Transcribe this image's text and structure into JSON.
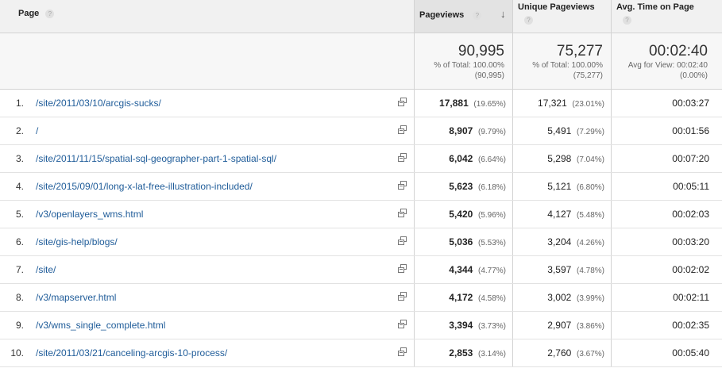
{
  "header": {
    "page_label": "Page",
    "pageviews_label": "Pageviews",
    "unique_label": "Unique Pageviews",
    "time_label": "Avg. Time on Page",
    "help_glyph": "?",
    "sort_glyph": "↓"
  },
  "summary": {
    "pageviews": {
      "total": "90,995",
      "line1": "% of Total: 100.00%",
      "line2": "(90,995)"
    },
    "unique": {
      "total": "75,277",
      "line1": "% of Total: 100.00%",
      "line2": "(75,277)"
    },
    "time": {
      "total": "00:02:40",
      "line1": "Avg for View: 00:02:40",
      "line2": "(0.00%)"
    }
  },
  "rows": [
    {
      "idx": "1.",
      "page": "/site/2011/03/10/arcgis-sucks/",
      "pv": "17,881",
      "pv_pct": "(19.65%)",
      "upv": "17,321",
      "upv_pct": "(23.01%)",
      "time": "00:03:27"
    },
    {
      "idx": "2.",
      "page": "/",
      "pv": "8,907",
      "pv_pct": "(9.79%)",
      "upv": "5,491",
      "upv_pct": "(7.29%)",
      "time": "00:01:56"
    },
    {
      "idx": "3.",
      "page": "/site/2011/11/15/spatial-sql-geographer-part-1-spatial-sql/",
      "pv": "6,042",
      "pv_pct": "(6.64%)",
      "upv": "5,298",
      "upv_pct": "(7.04%)",
      "time": "00:07:20"
    },
    {
      "idx": "4.",
      "page": "/site/2015/09/01/long-x-lat-free-illustration-included/",
      "pv": "5,623",
      "pv_pct": "(6.18%)",
      "upv": "5,121",
      "upv_pct": "(6.80%)",
      "time": "00:05:11"
    },
    {
      "idx": "5.",
      "page": "/v3/openlayers_wms.html",
      "pv": "5,420",
      "pv_pct": "(5.96%)",
      "upv": "4,127",
      "upv_pct": "(5.48%)",
      "time": "00:02:03"
    },
    {
      "idx": "6.",
      "page": "/site/gis-help/blogs/",
      "pv": "5,036",
      "pv_pct": "(5.53%)",
      "upv": "3,204",
      "upv_pct": "(4.26%)",
      "time": "00:03:20"
    },
    {
      "idx": "7.",
      "page": "/site/",
      "pv": "4,344",
      "pv_pct": "(4.77%)",
      "upv": "3,597",
      "upv_pct": "(4.78%)",
      "time": "00:02:02"
    },
    {
      "idx": "8.",
      "page": "/v3/mapserver.html",
      "pv": "4,172",
      "pv_pct": "(4.58%)",
      "upv": "3,002",
      "upv_pct": "(3.99%)",
      "time": "00:02:11"
    },
    {
      "idx": "9.",
      "page": "/v3/wms_single_complete.html",
      "pv": "3,394",
      "pv_pct": "(3.73%)",
      "upv": "2,907",
      "upv_pct": "(3.86%)",
      "time": "00:02:35"
    },
    {
      "idx": "10.",
      "page": "/site/2011/03/21/canceling-arcgis-10-process/",
      "pv": "2,853",
      "pv_pct": "(3.14%)",
      "upv": "2,760",
      "upv_pct": "(3.67%)",
      "time": "00:05:40"
    }
  ],
  "colors": {
    "link": "#1f5c99",
    "header_bg": "#f1f1f1",
    "summary_bg": "#f7f7f7"
  },
  "icons": {
    "row_action": "open-in-new-window-icon",
    "help": "help-icon",
    "sort": "sort-descending-icon"
  }
}
